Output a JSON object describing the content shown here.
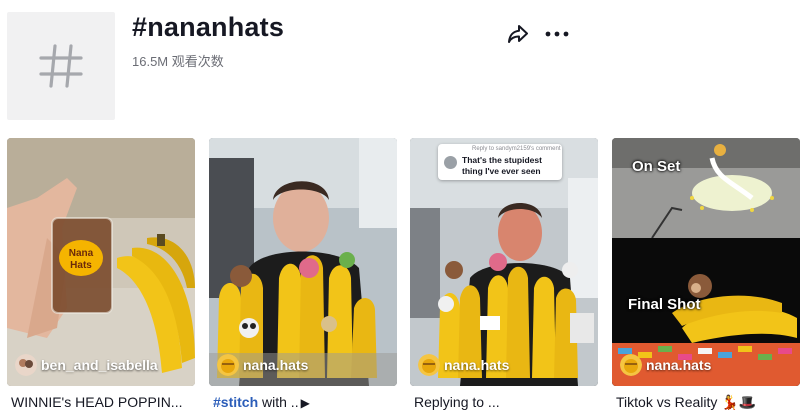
{
  "header": {
    "title": "#nananhats",
    "views": "16.5M 观看次数",
    "share_icon": "share-arrow-icon",
    "more_icon": "more-dots-icon",
    "avatar_icon": "hashtag-icon"
  },
  "videos": [
    {
      "creator": "ben_and_isabella",
      "caption_text": "WINNIE's HEAD POPPIN...",
      "caption_hashtag": "",
      "overlay_top": "",
      "overlay_bottom": ""
    },
    {
      "creator": "nana.hats",
      "caption_text": " with ..",
      "caption_hashtag": "#stitch",
      "overlay_top": "",
      "overlay_bottom": ""
    },
    {
      "creator": "nana.hats",
      "caption_text": "Replying to ...",
      "caption_hashtag": "",
      "reply_small": "Reply to sandym2159's comment",
      "reply_big": "That's the stupidest thing I've ever seen"
    },
    {
      "creator": "nana.hats",
      "caption_text": "Tiktok vs Reality 💃🎩",
      "caption_hashtag": "",
      "overlay_top": "On Set",
      "overlay_bottom": "Final Shot"
    }
  ],
  "colors": {
    "hashtag_link": "#2b5db9",
    "text_primary": "#161823",
    "text_secondary": "#6b6d75",
    "avatar_bg": "#f1f1f2"
  }
}
